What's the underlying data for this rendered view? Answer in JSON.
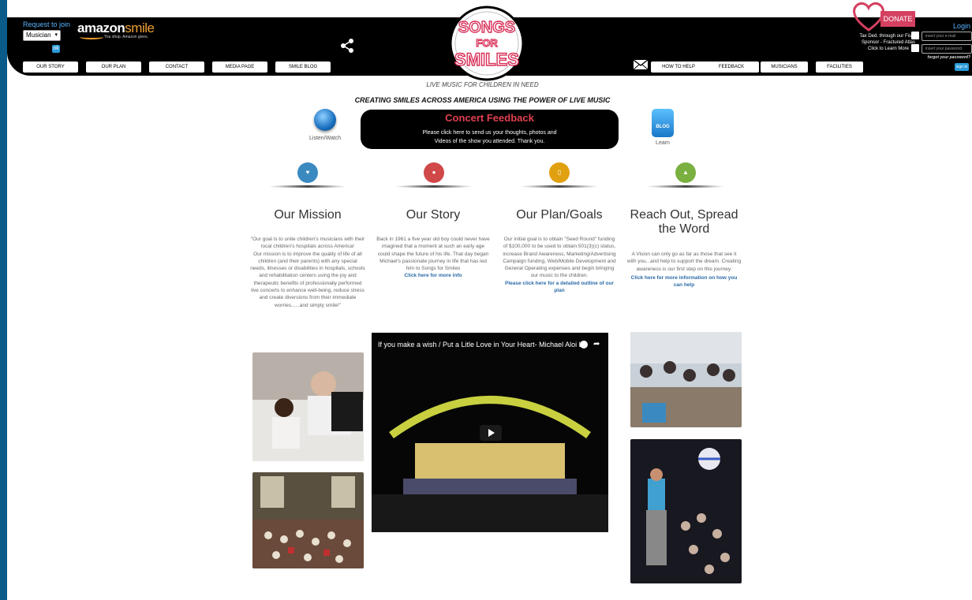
{
  "header": {
    "request_join": "Request to join",
    "select_value": "Musician",
    "go_label": "ok",
    "amazon_brand": "amazon",
    "amazon_smile": "smile",
    "amazon_tagline": "You shop. Amazon gives.",
    "nav_left": [
      "OUR STORY",
      "OUR PLAN",
      "CONTACT",
      "MEDIA PAGE",
      "SMILE BLOG"
    ],
    "nav_right": [
      "HOW TO HELP",
      "FEEDBACK",
      "MUSICIANS",
      "FACILITIES"
    ],
    "logo_text": [
      "SONGS",
      "FOR",
      "SMILES"
    ],
    "donate_label": "DONATE",
    "tax_text": "Tax Ded. through our Fiscal Sponsor - Fractured Atlas Click to Learn More",
    "login_label": "Login",
    "email_placeholder": "insert your e-mail",
    "password_placeholder": "insert your password",
    "forgot_label": "forgot your password?",
    "signin_label": "sign in"
  },
  "taglines": {
    "sub": "LIVE MUSIC FOR CHILDREN IN NEED",
    "main": "CREATING SMILES ACROSS AMERICA USING THE POWER OF LIVE MUSIC"
  },
  "listen_label": "Listen/Watch",
  "blog": {
    "icon_text": "BLOG",
    "label": "Learn"
  },
  "concert": {
    "title": "Concert Feedback",
    "line1": "Please click here to send us your thoughts, photos and",
    "line2": "Videos of the show you attended. Thank you."
  },
  "colors": {
    "mission": "#3a8ac0",
    "story": "#d04848",
    "plan": "#e0a010",
    "reach": "#7ab040"
  },
  "columns": {
    "mission": {
      "title": "Our Mission",
      "body": "\"Our goal is to unite children's musicians with their local children's hospitals across America!\nOur mission is to improve the quality of life of all children (and their parents) with any special needs, illnesses or disabilities in hospitals, schools and rehabilitation centers using the joy and therapeutic benefits of professionally performed live concerts to enhance well-being, reduce stress and create diversions from their immediate worries......and simply smile!\""
    },
    "story": {
      "title": "Our Story",
      "body": "Back in 1961 a five year old boy could never have imagined that a moment at such an early age could shape the future of his life. That day began Michael's passionate journey in life that has led him to Songs for Smiles",
      "link": "Click here for more info"
    },
    "plan": {
      "title": "Our Plan/Goals",
      "body": "Our initial goal is to obtain \"Seed Round\" funding of $100,000 to be used to obtain 501(3)(c) status, increase Brand Awareness, Marketing/Advertising Campaign funding, Web/Mobile Development and General Operating expenses and begin bringing our music to the children.",
      "link": "Please click here for a detailed outline of our plan"
    },
    "reach": {
      "title": "Reach Out, Spread the Word",
      "body": "A Vision can only go as far as those that see it with you...and help to support the dream. Creating awareness is our first step on this journey.",
      "link": "Click here for more information on how you can help"
    }
  },
  "video": {
    "title": "If you make a wish / Put a Litle Love in Your Heart- Michael Aloi Liv..."
  }
}
